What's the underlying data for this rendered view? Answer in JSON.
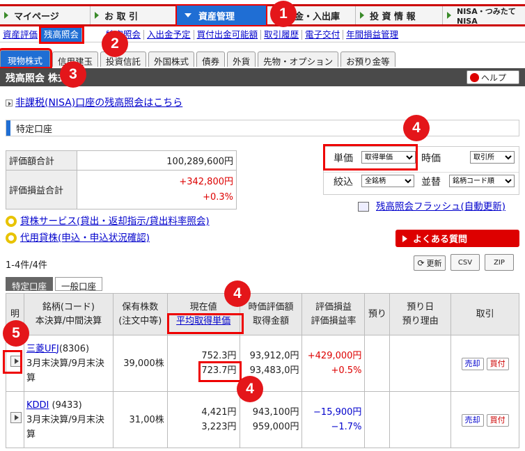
{
  "nav": {
    "tabs": [
      "マイページ",
      "お 取 引",
      "資産管理",
      "金・入出庫",
      "投 資 情 報",
      "NISA・つみたてNISA"
    ]
  },
  "subnav": [
    "資産評価",
    "残高照会",
    "特定照会",
    "入出金予定",
    "買付出金可能額",
    "取引履歴",
    "電子交付",
    "年間損益管理"
  ],
  "product_tabs": [
    "現物株式",
    "信用建玉",
    "投資信託",
    "外国株式",
    "債券",
    "外貨",
    "先物・オプション",
    "お預り金等"
  ],
  "title": "残高照会 株式",
  "help_label": "ヘルプ",
  "nisa_link": "非課税(NISA)口座の残高照会はこちら",
  "account_type": "特定口座",
  "summary": {
    "eval_total_label": "評価額合計",
    "eval_total": "100,289,600円",
    "pl_total_label": "評価損益合計",
    "pl_total": "+342,800円",
    "pl_pct": "+0.3%"
  },
  "controls": {
    "unit_label": "単価",
    "unit_value": "取得単価",
    "price_label": "時価",
    "price_value": "取引所",
    "filter_label": "絞込",
    "filter_value": "全銘柄",
    "sort_label": "並替",
    "sort_value": "銘柄コード順"
  },
  "links": {
    "lending": "貸株サービス(貸出・返却指示/貸出料率照会)",
    "collateral": "代用貸株(申込・申込状況確認)",
    "flash": "残高照会フラッシュ(自動更新)"
  },
  "faq": "よくある質問",
  "count_text": "1-4件/4件",
  "buttons": {
    "refresh": "更新",
    "csv": "CSV",
    "zip": "ZIP"
  },
  "acct_tabs": [
    "特定口座",
    "一般口座"
  ],
  "table": {
    "headers": {
      "c1": "明",
      "c2a": "銘柄(コード)",
      "c2b": "本決算/中間決算",
      "c3a": "保有株数",
      "c3b": "(注文中等)",
      "c4a": "現在値",
      "c4b": "平均取得単価",
      "c5a": "時価評価額",
      "c5b": "取得金額",
      "c6a": "評価損益",
      "c6b": "評価損益率",
      "c7": "預り",
      "c8a": "預り日",
      "c8b": "預り理由",
      "c9": "取引"
    },
    "rows": [
      {
        "name": "三菱UFJ",
        "code": "(8306)",
        "settle": "3月末決算/9月末決算",
        "shares": "39,000株",
        "price": "752.3円",
        "avg": "723.7円",
        "value": "93,912,0円",
        "cost": "93,483,0円",
        "pl": "+429,000円",
        "plpct": "+0.5%",
        "sell": "売却",
        "buy": "買付"
      },
      {
        "name": "KDDI",
        "code": "(9433)",
        "settle": "3月末決算/9月末決算",
        "shares": "31,00株",
        "price": "4,421円",
        "avg": "3,223円",
        "value": "943,100円",
        "cost": "959,000円",
        "pl": "−15,900円",
        "plpct": "−1.7%",
        "sell": "売却",
        "buy": "買付"
      }
    ]
  },
  "markers": [
    "1",
    "2",
    "3",
    "4",
    "4",
    "4",
    "5"
  ]
}
